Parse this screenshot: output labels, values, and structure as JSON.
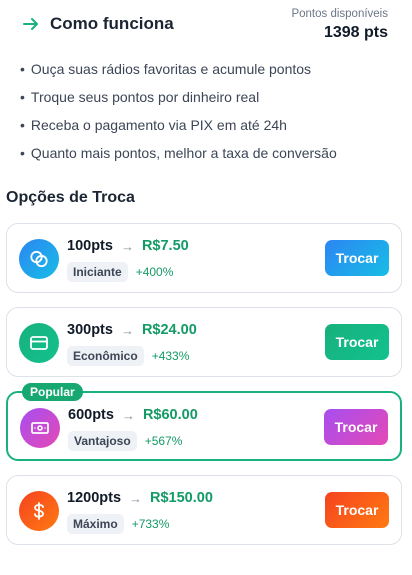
{
  "how_it_works": {
    "title": "Como funciona",
    "points_label": "Pontos disponíveis",
    "points_value": "1398 pts",
    "bullets": [
      "Ouça suas rádios favoritas e acumule pontos",
      "Troque seus pontos por dinheiro real",
      "Receba o pagamento via PIX em até 24h",
      "Quanto mais pontos, melhor a taxa de conversão"
    ]
  },
  "options": {
    "title": "Opções de Troca",
    "popular_label": "Popular",
    "items": [
      {
        "points": "100pts",
        "money": "R$7.50",
        "tier": "Iniciante",
        "bonus": "+400%",
        "button": "Trocar",
        "icon": "coins-icon"
      },
      {
        "points": "300pts",
        "money": "R$24.00",
        "tier": "Econômico",
        "bonus": "+433%",
        "button": "Trocar",
        "icon": "credit-card-icon"
      },
      {
        "points": "600pts",
        "money": "R$60.00",
        "tier": "Vantajoso",
        "bonus": "+567%",
        "button": "Trocar",
        "icon": "banknote-icon"
      },
      {
        "points": "1200pts",
        "money": "R$150.00",
        "tier": "Máximo",
        "bonus": "+733%",
        "button": "Trocar",
        "icon": "dollar-sign-icon"
      }
    ]
  },
  "colors": {
    "green_accent": "#149a66",
    "blue_gradient": [
      "#2b86f3",
      "#18bde6"
    ],
    "green_gradient": [
      "#17b07c",
      "#12c28e"
    ],
    "purple_gradient": [
      "#a74ef0",
      "#e449b5"
    ],
    "orange_gradient": [
      "#f5431f",
      "#ff7a12"
    ]
  }
}
